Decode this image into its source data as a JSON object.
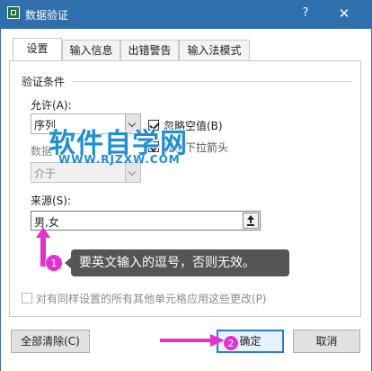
{
  "window": {
    "title": "数据验证",
    "help_label": "?",
    "close_label": "✕"
  },
  "tabs": [
    {
      "label": "设置",
      "active": true
    },
    {
      "label": "输入信息",
      "active": false
    },
    {
      "label": "出错警告",
      "active": false
    },
    {
      "label": "输入法模式",
      "active": false
    }
  ],
  "criteria": {
    "group_label": "验证条件",
    "allow_label": "允许(A):",
    "allow_value": "序列",
    "ignore_blank_label": "忽略空值(B)",
    "ignore_blank_checked": true,
    "dropdown_label": "提供下拉箭头",
    "dropdown_checked": true,
    "data_label": "数据",
    "data_value": "介于",
    "source_label": "来源(S):",
    "source_value": "男,女"
  },
  "apply_all_label": "对有同样设置的所有其他单元格应用这些更改(P)",
  "buttons": {
    "clear_all": "全部清除(C)",
    "ok": "确定",
    "cancel": "取消"
  },
  "annotations": {
    "badge_1": "1",
    "tooltip": "要英文输入的逗号，否则无效。",
    "badge_2": "2",
    "accent_color": "#e62fd2"
  },
  "watermark": {
    "main": "软件自学网",
    "url": "WWW.RJZXW.COM"
  },
  "colors": {
    "titlebar": "#2f6fad",
    "watermark": "#1f8ed8",
    "tooltip_bg": "#555555"
  }
}
